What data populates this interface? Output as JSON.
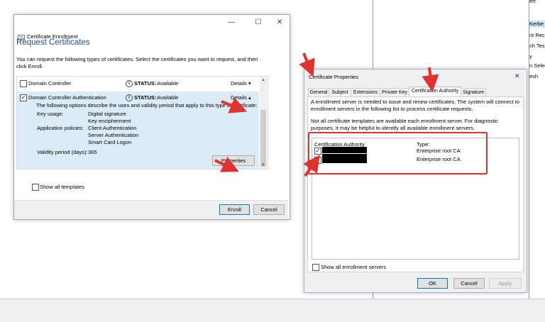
{
  "background_app": {
    "right_panel_items": [
      {
        "label": "ert",
        "selected": false
      },
      {
        "label": "Kerbe",
        "selected": true
      },
      {
        "label": "nt Rec",
        "selected": false
      },
      {
        "label": "nt Tes",
        "selected": false
      },
      {
        "label": "ch Tes",
        "selected": false
      },
      {
        "label": "y",
        "selected": false
      },
      {
        "label": "n Selec",
        "selected": false
      },
      {
        "label": "on Sele",
        "selected": false
      },
      {
        "label": "esh",
        "selected": false
      },
      {
        "label": "rt",
        "selected": false
      },
      {
        "label": "",
        "selected": false
      }
    ]
  },
  "enroll_window": {
    "title": "Certificate Enrollment",
    "controls": {
      "minimize": "—",
      "maximize": "☐",
      "close": "✕"
    },
    "heading": "Request Certificates",
    "description": "You can request the following types of certificates. Select the certificates you want to request, and then click Enroll.",
    "certificates": [
      {
        "name": "Domain Controller",
        "checked": false,
        "status_label": "STATUS:",
        "status": "Available",
        "details_label": "Details",
        "expanded": false
      },
      {
        "name": "Domain Controller Authentication",
        "checked": true,
        "status_label": "STATUS:",
        "status": "Available",
        "details_label": "Details",
        "expanded": true
      }
    ],
    "details_intro": "The following options describe the uses and validity period that apply to this type of certificate:",
    "key_usage_label": "Key usage:",
    "key_usage_values": [
      "Digital signature",
      "Key encipherment"
    ],
    "app_policies_label": "Application policies:",
    "app_policies_values": [
      "Client Authentication",
      "Server Authentication",
      "Smart Card Logon"
    ],
    "validity_label": "Validity period (days):",
    "validity_value": "365",
    "properties_button": "Properties",
    "show_all_templates": "Show all templates",
    "enroll_button": "Enroll",
    "cancel_button": "Cancel"
  },
  "properties_window": {
    "title": "Certificate Properties",
    "close": "✕",
    "tabs": [
      "General",
      "Subject",
      "Extensions",
      "Private Key",
      "Certification Authority",
      "Signature"
    ],
    "active_tab": "Certification Authority",
    "para1": "A enrollment server is needed to issue and renew certificates. The system will connect to enrollment servers in the following list to process certificate requests.",
    "para2": "Not all certificate templates are available each enrollment server. For diagnostic purposes, it may be helpful to identify all available enrollment servers.",
    "col_ca": "Certification Authority",
    "col_type": "Type:",
    "rows": [
      {
        "checked": true,
        "type": "Enterprise root CA"
      },
      {
        "checked": true,
        "type": "Enterprise root CA"
      }
    ],
    "show_all_servers": "Show all enrollment servers",
    "ok_button": "OK",
    "cancel_button": "Cancel",
    "apply_button": "Apply"
  },
  "colors": {
    "accent": "#1e4e9a",
    "highlight_red": "#e0322f",
    "selection": "#dcebf8"
  }
}
